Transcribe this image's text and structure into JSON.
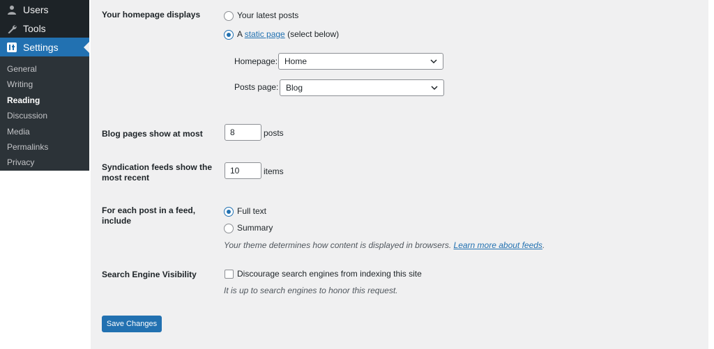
{
  "sidebar": {
    "menu": [
      {
        "label": "Users",
        "icon": "user-icon"
      },
      {
        "label": "Tools",
        "icon": "wrench-icon"
      },
      {
        "label": "Settings",
        "icon": "settings-icon",
        "current": true
      }
    ],
    "submenu": [
      "General",
      "Writing",
      "Reading",
      "Discussion",
      "Media",
      "Permalinks",
      "Privacy"
    ],
    "current_sub": "Reading"
  },
  "form": {
    "homepage_displays": {
      "label": "Your homepage displays",
      "option_latest": "Your latest posts",
      "option_static_prefix": "A",
      "option_static_link": "static page",
      "option_static_suffix": "(select below)",
      "selected": "static"
    },
    "homepage_select": {
      "label": "Homepage:",
      "value": "Home"
    },
    "posts_select": {
      "label": "Posts page:",
      "value": "Blog"
    },
    "blog_pages": {
      "label": "Blog pages show at most",
      "value": "8",
      "unit": "posts"
    },
    "syndication": {
      "label_line1": "Syndication feeds show the",
      "label_line2": "most recent",
      "value": "10",
      "unit": "items"
    },
    "feed_include": {
      "label_line1": "For each post in a feed,",
      "label_line2": "include",
      "option_full": "Full text",
      "option_summary": "Summary",
      "selected": "full",
      "desc_text": "Your theme determines how content is displayed in browsers.",
      "desc_link": "Learn more about feeds",
      "desc_end": "."
    },
    "search_visibility": {
      "label": "Search Engine Visibility",
      "checkbox_label": "Discourage search engines from indexing this site",
      "checked": false,
      "desc": "It is up to search engines to honor this request."
    },
    "save_label": "Save Changes"
  },
  "colors": {
    "accent": "#2271b1",
    "sidebar_bg": "#1d2327",
    "content_bg": "#f0f0f1"
  }
}
